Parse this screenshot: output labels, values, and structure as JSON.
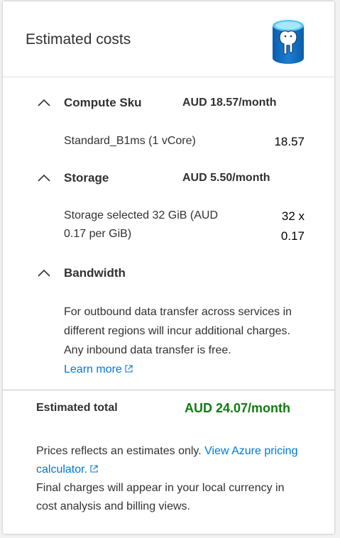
{
  "panel": {
    "title": "Estimated costs",
    "logo_icon": "postgresql-database-icon"
  },
  "sections": [
    {
      "title": "Compute Sku",
      "cost": "AUD 18.57/month",
      "item_label": "Standard_B1ms (1 vCore)",
      "item_value": "18.57"
    },
    {
      "title": "Storage",
      "cost": "AUD 5.50/month",
      "item_label_line1": "Storage selected 32 GiB (AUD",
      "item_label_line2": "0.17 per GiB)",
      "item_value_line1": "32 x",
      "item_value_line2": "0.17"
    },
    {
      "title": "Bandwidth",
      "description": "For outbound data transfer across services in different regions will incur additional charges. Any inbound data transfer is free.",
      "link": "Learn more"
    }
  ],
  "total": {
    "label": "Estimated total",
    "value": "AUD 24.07/month",
    "color": "#107c10"
  },
  "footer": {
    "text1": "Prices reflects an estimates only.",
    "link": "View Azure pricing calculator.",
    "text2": "Final charges will appear in your local currency in cost analysis and billing views."
  },
  "colors": {
    "link": "#0078d4",
    "total": "#107c10",
    "logo_blue": "#0f6cbd"
  }
}
